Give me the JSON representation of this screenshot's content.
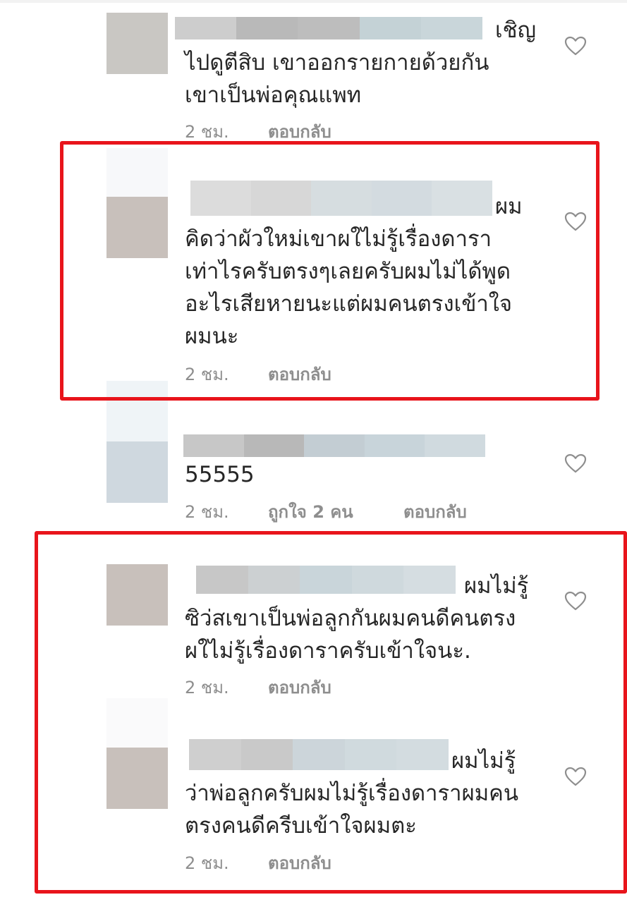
{
  "colors": {
    "highlight_border": "#e8141b",
    "meta_text": "#8e8e8e",
    "body_text": "#262626",
    "heart_outline": "#8e8e8e"
  },
  "comments": [
    {
      "text_lines": [
        "เชิญ",
        "ไปดูตีสิบ เขาออกรายกายด้วยกัน",
        "เขาเป็นพ่อคุณแพท"
      ],
      "time": "2 ชม.",
      "likes": "",
      "reply": "ตอบกลับ",
      "like_icon": "heart-outline-icon",
      "highlighted": false
    },
    {
      "text_lines": [
        "ผม",
        "คิดว่าผัวใหม่เขาผใไม่รู้เรื่องดารา",
        "เท่าไรครับตรงๆเลยครับผมไม่ได้พูด",
        "อะไรเสียหายนะแต่ผมคนตรงเข้าใจ",
        "ผมนะ"
      ],
      "time": "2 ชม.",
      "likes": "",
      "reply": "ตอบกลับ",
      "like_icon": "heart-outline-icon",
      "highlighted": true
    },
    {
      "text_lines": [
        "55555"
      ],
      "time": "2 ชม.",
      "likes": "ถูกใจ 2 คน",
      "reply": "ตอบกลับ",
      "like_icon": "heart-outline-icon",
      "highlighted": false
    },
    {
      "text_lines": [
        "ผมไม่รู้",
        "ซิว่สเขาเป็นพ่อลูกกันผมคนดีคนตรง",
        "ผใไม่รู้เรื่องดาราครับเข้าใจนะ."
      ],
      "time": "2 ชม.",
      "likes": "",
      "reply": "ตอบกลับ",
      "like_icon": "heart-outline-icon",
      "highlighted": true
    },
    {
      "text_lines": [
        "ผมไม่รู้",
        "ว่าพ่อลูกครับผมไม่รู้เรื่องดาราผมคน",
        "ตรงคนดีครีบเข้าใจผมตะ"
      ],
      "time": "2 ชม.",
      "likes": "",
      "reply": "ตอบกลับ",
      "like_icon": "heart-outline-icon",
      "highlighted": true
    }
  ]
}
